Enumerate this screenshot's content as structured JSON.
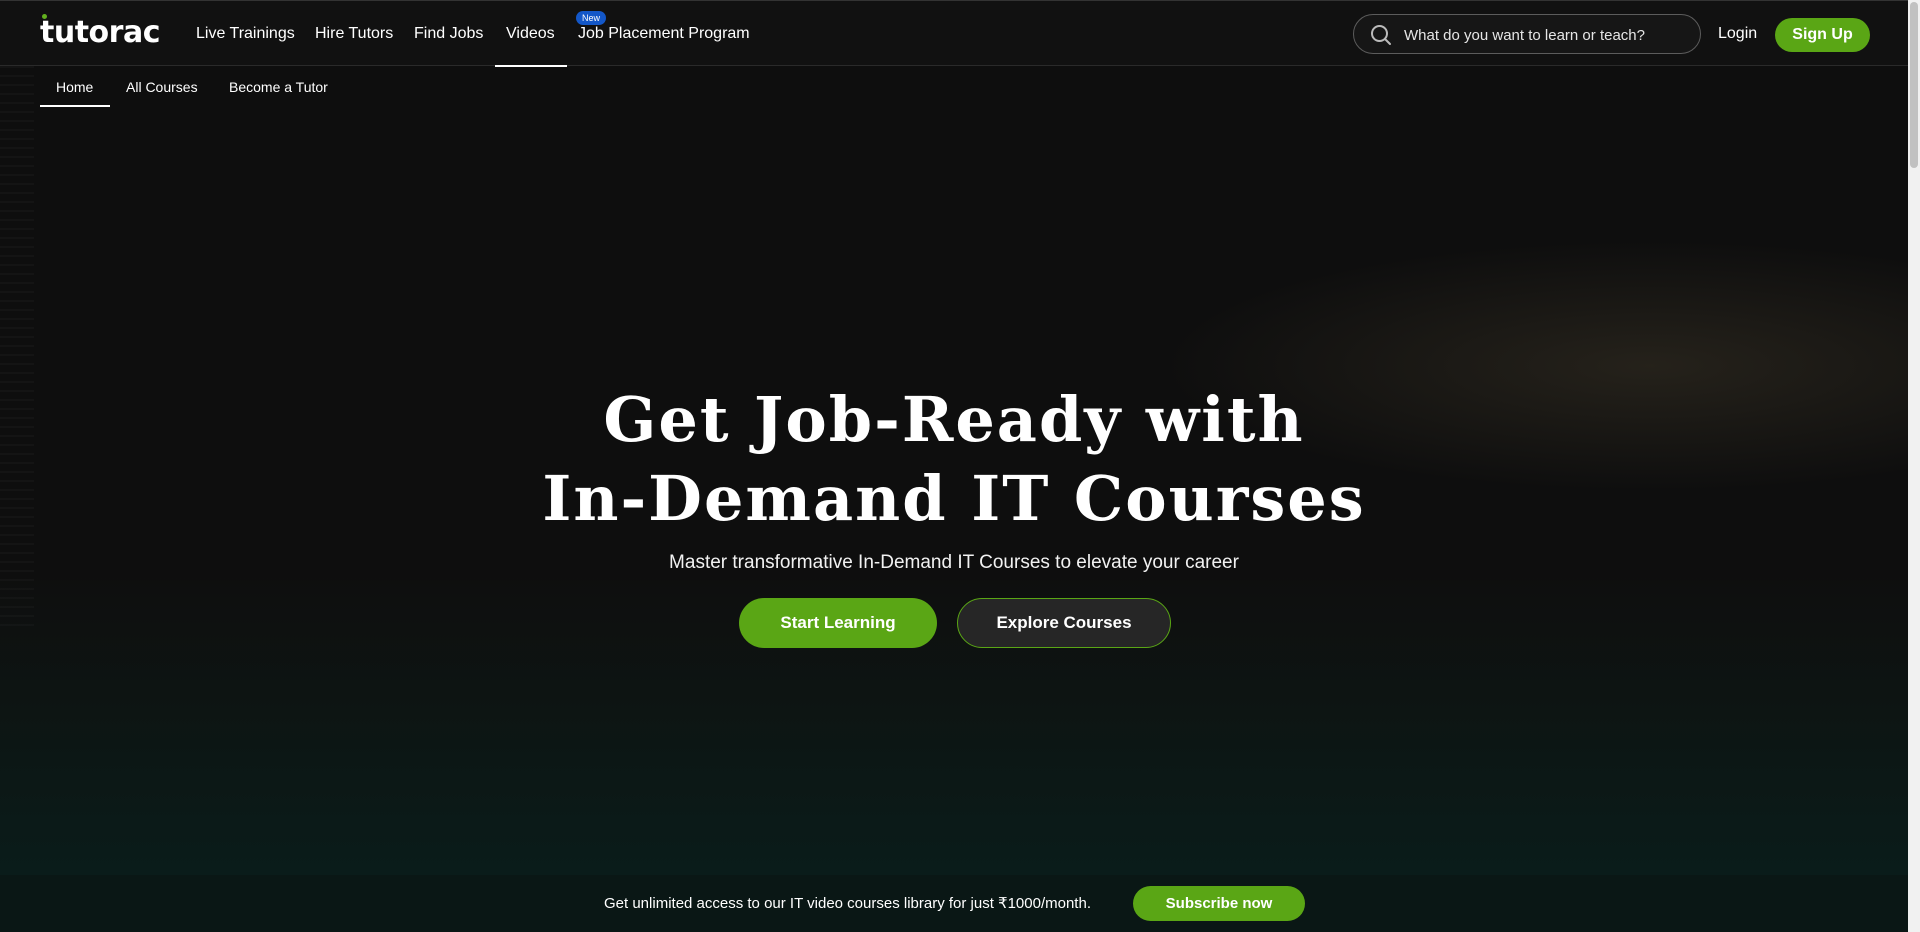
{
  "app": {
    "logo": "tutorac"
  },
  "header": {
    "nav": [
      {
        "label": "Live Trainings"
      },
      {
        "label": "Hire Tutors"
      },
      {
        "label": "Find Jobs"
      },
      {
        "label": "Videos",
        "active": true
      },
      {
        "label": "Job Placement Program",
        "badge": "New"
      }
    ],
    "search": {
      "placeholder": "What do you want to learn or teach?",
      "value": "",
      "icon": "search-icon"
    },
    "login_label": "Login",
    "signup_label": "Sign Up"
  },
  "subnav": {
    "items": [
      {
        "label": "Home",
        "active": true
      },
      {
        "label": "All Courses"
      },
      {
        "label": "Become a Tutor"
      }
    ]
  },
  "hero": {
    "title_line1": "Get Job-Ready with",
    "title_line2": "In-Demand IT Courses",
    "subtitle": "Master transformative In-Demand IT Courses to elevate your career",
    "primary_button": "Start Learning",
    "secondary_button": "Explore Courses"
  },
  "banner": {
    "text": "Get unlimited access to our IT video courses library for just ₹1000/month.",
    "button": "Subscribe now"
  },
  "colors": {
    "accent": "#5aa615",
    "badge": "#1357c8",
    "background": "#0f0f0f",
    "banner_bg": "#0a1715"
  }
}
